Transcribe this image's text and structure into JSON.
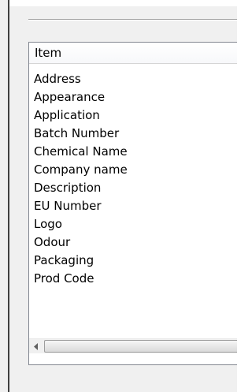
{
  "listview": {
    "header": "Item",
    "items": [
      "Address",
      "Appearance",
      "Application",
      "Batch Number",
      "Chemical Name",
      "Company name",
      "Description",
      "EU Number",
      "Logo",
      "Odour",
      "Packaging",
      "Prod Code"
    ]
  },
  "scrollbar": {
    "left_arrow_icon": "chevron-left-icon"
  }
}
